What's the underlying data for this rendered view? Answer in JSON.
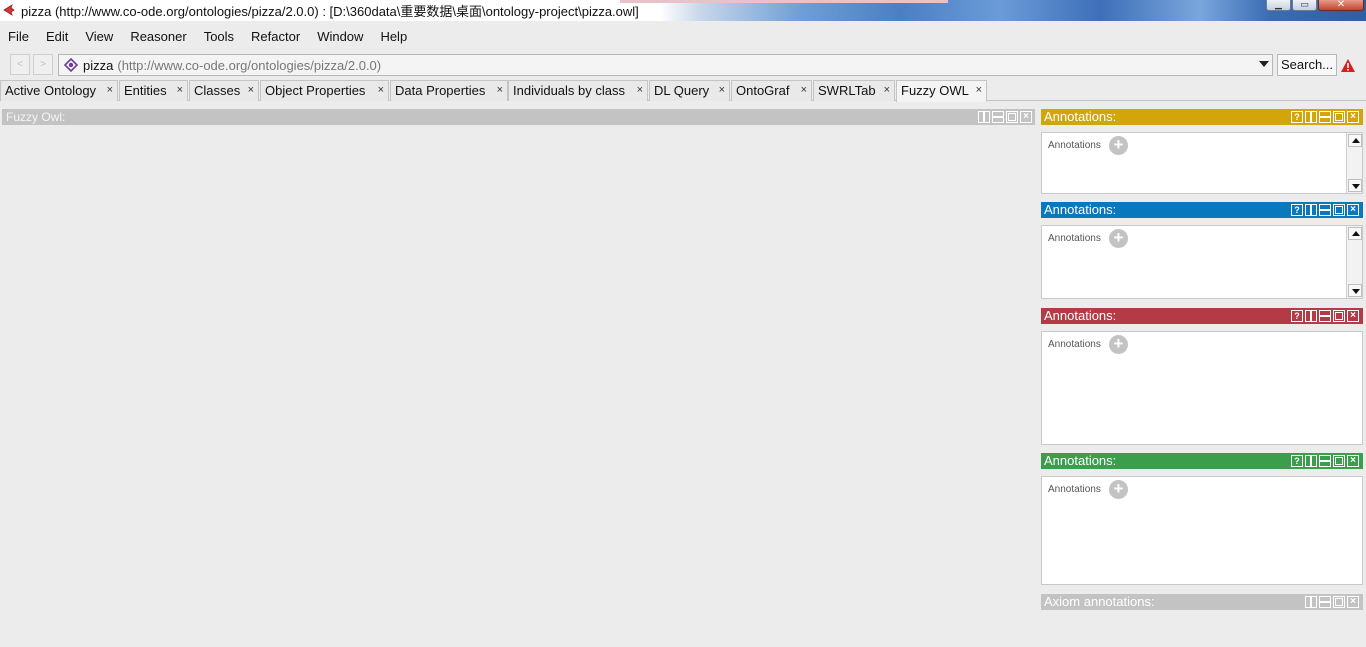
{
  "window": {
    "title": "pizza (http://www.co-ode.org/ontologies/pizza/2.0.0)  : [D:\\360data\\重要数据\\桌面\\ontology-project\\pizza.owl]"
  },
  "menu": [
    "File",
    "Edit",
    "View",
    "Reasoner",
    "Tools",
    "Refactor",
    "Window",
    "Help"
  ],
  "address": {
    "ontology_name": "pizza",
    "ontology_iri": "(http://www.co-ode.org/ontologies/pizza/2.0.0)",
    "search_label": "Search..."
  },
  "tabs": [
    {
      "label": "Active Ontology"
    },
    {
      "label": "Entities"
    },
    {
      "label": "Classes"
    },
    {
      "label": "Object Properties"
    },
    {
      "label": "Data Properties"
    },
    {
      "label": "Individuals by class"
    },
    {
      "label": "DL Query"
    },
    {
      "label": "OntoGraf"
    },
    {
      "label": "SWRLTab"
    },
    {
      "label": "Fuzzy OWL"
    }
  ],
  "tab_close_glyph": "×",
  "active_tab": "Fuzzy OWL",
  "left_view": {
    "title": "Fuzzy Owl:"
  },
  "panels": [
    {
      "title": "Annotations:",
      "color": "#d2a50b",
      "content_label": "Annotations"
    },
    {
      "title": "Annotations:",
      "color": "#0a78bd",
      "content_label": "Annotations"
    },
    {
      "title": "Annotations:",
      "color": "#b43a45",
      "content_label": "Annotations"
    },
    {
      "title": "Annotations:",
      "color": "#3a9e4c",
      "content_label": "Annotations"
    },
    {
      "title": "Axiom annotations:",
      "color": "#c3c3c3"
    }
  ]
}
